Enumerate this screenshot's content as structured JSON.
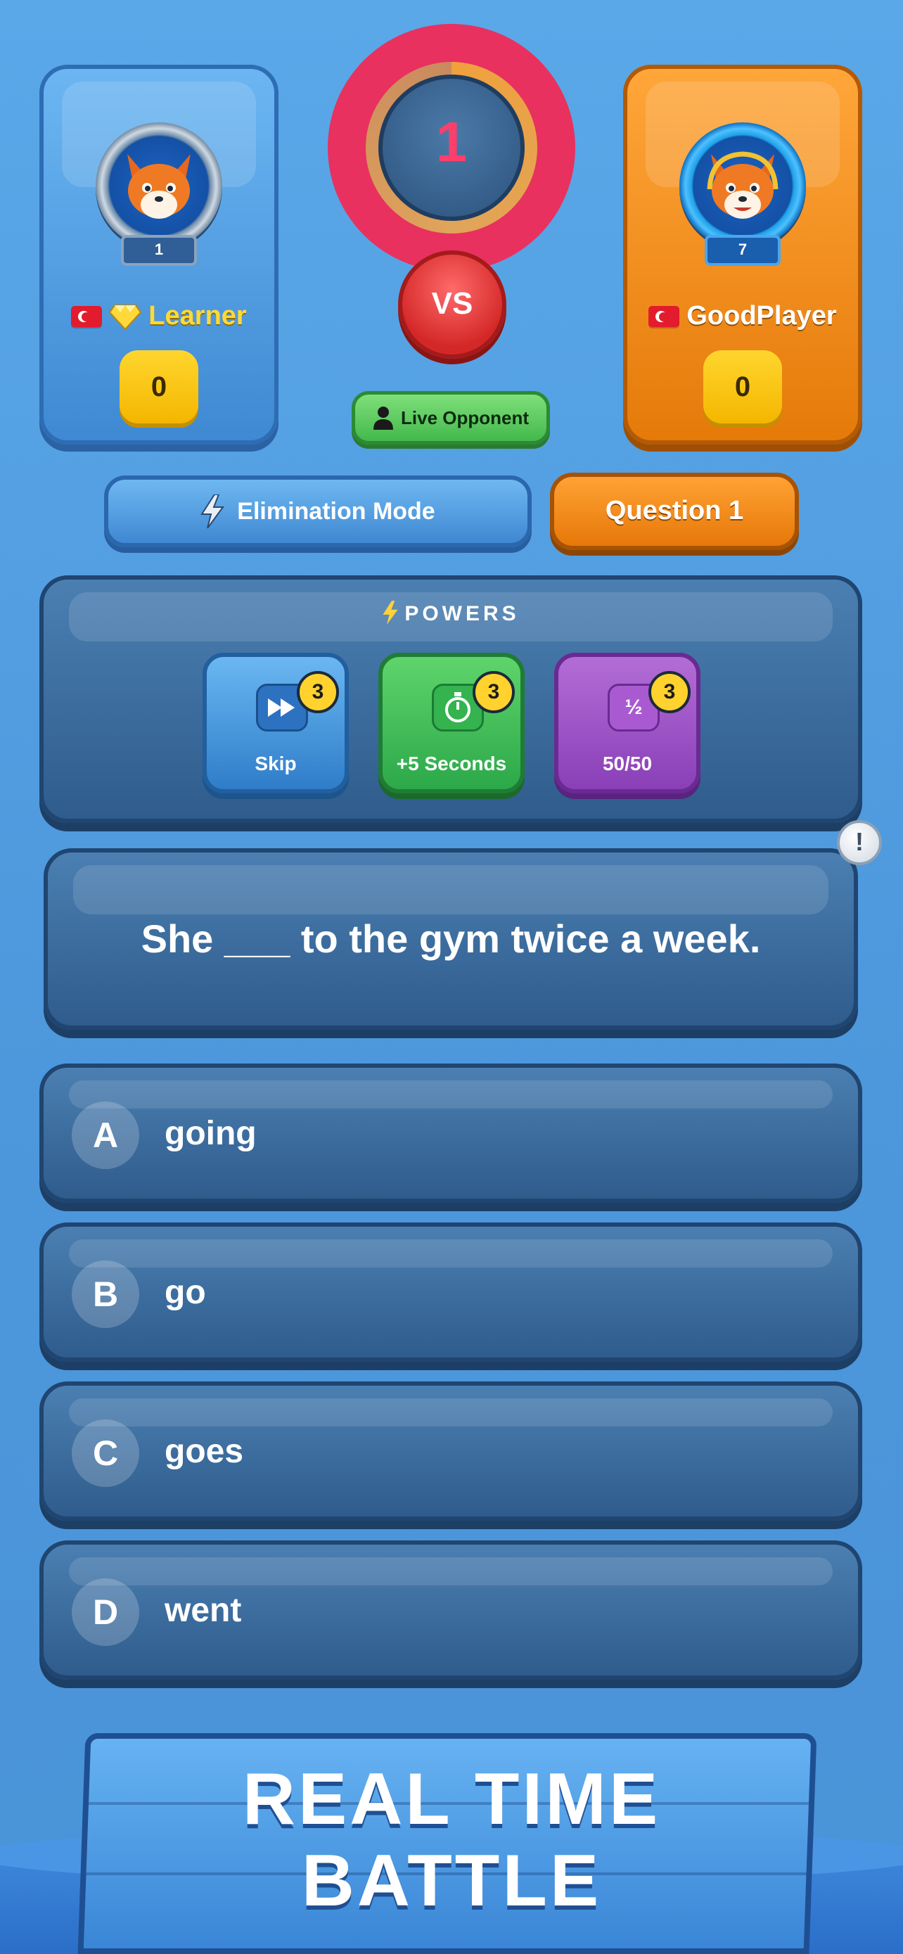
{
  "players": {
    "left": {
      "name": "Learner",
      "level": "1",
      "score": "0",
      "flag": "turkey-flag-icon",
      "badge": "diamond-icon"
    },
    "right": {
      "name": "GoodPlayer",
      "level": "7",
      "score": "0",
      "flag": "turkey-flag-icon"
    }
  },
  "timer": {
    "value": "1"
  },
  "vs_label": "VS",
  "live_opponent_label": "Live Opponent",
  "mode_label": "Elimination Mode",
  "question_label": "Question 1",
  "powers": {
    "title": "POWERS",
    "items": [
      {
        "label": "Skip",
        "count": "3",
        "icon": "fast-forward-icon",
        "color": "#3a8ee0"
      },
      {
        "label": "+5 Seconds",
        "count": "3",
        "icon": "stopwatch-icon",
        "color": "#3cbc55"
      },
      {
        "label": "50/50",
        "count": "3",
        "icon": "half-icon",
        "glyph": "½",
        "color": "#9b4fc6"
      }
    ]
  },
  "question": {
    "text": "She ___ to the gym twice a week."
  },
  "report_glyph": "!",
  "answers": [
    {
      "letter": "A",
      "text": "going"
    },
    {
      "letter": "B",
      "text": "go"
    },
    {
      "letter": "C",
      "text": "goes"
    },
    {
      "letter": "D",
      "text": "went"
    }
  ],
  "banner": {
    "line1": "REAL TIME",
    "line2": "BATTLE"
  },
  "colors": {
    "accent_orange": "#f08a14",
    "accent_blue": "#4b97dc",
    "timer_pink": "#e8315f",
    "vs_red": "#d42828"
  }
}
